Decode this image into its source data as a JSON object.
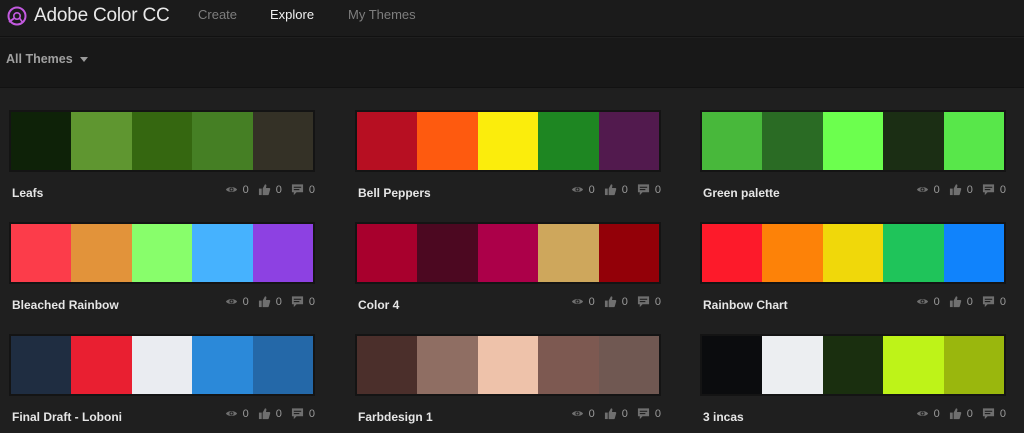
{
  "app": {
    "brand": "Adobe Color CC",
    "nav": [
      {
        "label": "Create",
        "active": false
      },
      {
        "label": "Explore",
        "active": true
      },
      {
        "label": "My Themes",
        "active": false
      }
    ]
  },
  "filter": {
    "label": "All Themes"
  },
  "themes": [
    {
      "name": "Leafs",
      "colors": [
        "#0e2208",
        "#5f9630",
        "#356710",
        "#457f24",
        "#343126"
      ],
      "views": "0",
      "likes": "0",
      "comments": "0"
    },
    {
      "name": "Bell Peppers",
      "colors": [
        "#b70f22",
        "#fe5a0f",
        "#fbed0c",
        "#1e8622",
        "#521a4e"
      ],
      "views": "0",
      "likes": "0",
      "comments": "0"
    },
    {
      "name": "Green palette",
      "colors": [
        "#48b83b",
        "#2a6b24",
        "#6cff4e",
        "#1b2e14",
        "#58e74a"
      ],
      "views": "0",
      "likes": "0",
      "comments": "0"
    },
    {
      "name": "Bleached Rainbow",
      "colors": [
        "#fc3c4a",
        "#e2933a",
        "#88fe6b",
        "#46b2fe",
        "#8d41e2"
      ],
      "views": "0",
      "likes": "0",
      "comments": "0"
    },
    {
      "name": "Color 4",
      "colors": [
        "#a8002d",
        "#4c0821",
        "#ac0049",
        "#cea75c",
        "#930008"
      ],
      "views": "0",
      "likes": "0",
      "comments": "0"
    },
    {
      "name": "Rainbow Chart",
      "colors": [
        "#fd1a2a",
        "#fd8208",
        "#f0d80a",
        "#1fc45a",
        "#1083fc"
      ],
      "views": "0",
      "likes": "0",
      "comments": "0"
    },
    {
      "name": "Final Draft - Loboni",
      "colors": [
        "#1f2d41",
        "#e91f31",
        "#eaecf1",
        "#2b89d9",
        "#2468a8"
      ],
      "views": "0",
      "likes": "0",
      "comments": "0"
    },
    {
      "name": "Farbdesign 1",
      "colors": [
        "#4b2f2b",
        "#8f6e63",
        "#eec2aa",
        "#7d5951",
        "#705852"
      ],
      "views": "0",
      "likes": "0",
      "comments": "0"
    },
    {
      "name": "3 incas",
      "colors": [
        "#0b0c0e",
        "#eceef1",
        "#1a2f0f",
        "#bef318",
        "#9ab70d"
      ],
      "views": "0",
      "likes": "0",
      "comments": "0"
    }
  ]
}
